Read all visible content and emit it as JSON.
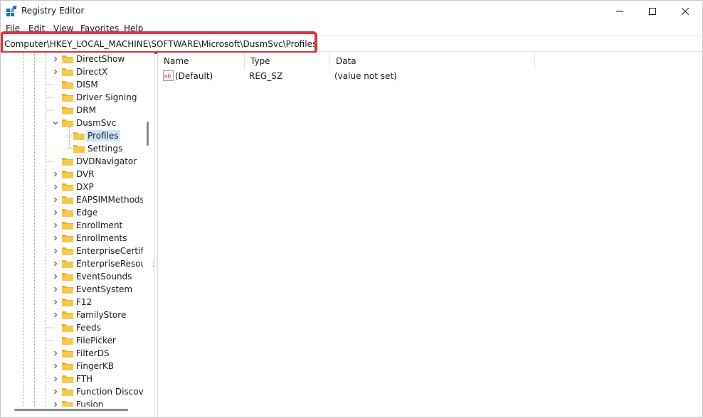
{
  "window": {
    "title": "Registry Editor",
    "icon": "registry-editor-icon"
  },
  "menu": {
    "items": [
      "File",
      "Edit",
      "View",
      "Favorites",
      "Help"
    ]
  },
  "address": {
    "path": "Computer\\HKEY_LOCAL_MACHINE\\SOFTWARE\\Microsoft\\DusmSvc\\Profiles",
    "highlight_color": "#e0333a"
  },
  "tree": {
    "items": [
      {
        "label": "DirectShow",
        "expandable": true
      },
      {
        "label": "DirectX",
        "expandable": true
      },
      {
        "label": "DISM",
        "expandable": false
      },
      {
        "label": "Driver Signing",
        "expandable": false
      },
      {
        "label": "DRM",
        "expandable": false
      },
      {
        "label": "DusmSvc",
        "expandable": true,
        "expanded": true
      },
      {
        "label": "Profiles",
        "expandable": false,
        "selected": true,
        "child": true
      },
      {
        "label": "Settings",
        "expandable": false,
        "child": true
      },
      {
        "label": "DVDNavigator",
        "expandable": false
      },
      {
        "label": "DVR",
        "expandable": true
      },
      {
        "label": "DXP",
        "expandable": true
      },
      {
        "label": "EAPSIMMethods",
        "expandable": true
      },
      {
        "label": "Edge",
        "expandable": true
      },
      {
        "label": "Enrollment",
        "expandable": true
      },
      {
        "label": "Enrollments",
        "expandable": true
      },
      {
        "label": "EnterpriseCertific",
        "expandable": true
      },
      {
        "label": "EnterpriseResourc",
        "expandable": true
      },
      {
        "label": "EventSounds",
        "expandable": true
      },
      {
        "label": "EventSystem",
        "expandable": true
      },
      {
        "label": "F12",
        "expandable": true
      },
      {
        "label": "FamilyStore",
        "expandable": true
      },
      {
        "label": "Feeds",
        "expandable": false
      },
      {
        "label": "FilePicker",
        "expandable": false
      },
      {
        "label": "FilterDS",
        "expandable": true
      },
      {
        "label": "FingerKB",
        "expandable": true
      },
      {
        "label": "FTH",
        "expandable": true
      },
      {
        "label": "Function Discove",
        "expandable": true
      },
      {
        "label": "Fusion",
        "expandable": true
      }
    ],
    "selection_color": "#cce4f7",
    "folder_color": "#f7c948"
  },
  "values": {
    "columns": [
      "Name",
      "Type",
      "Data"
    ],
    "rows": [
      {
        "name": "(Default)",
        "type": "REG_SZ",
        "data": "(value not set)",
        "icon": "string-value-icon"
      }
    ]
  }
}
